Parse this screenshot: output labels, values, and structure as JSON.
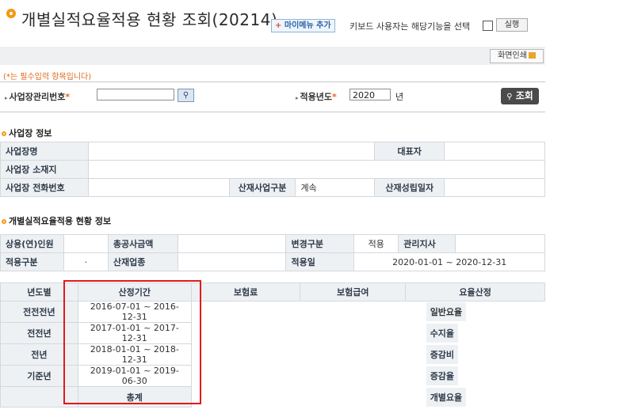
{
  "header": {
    "title": "개별실적요율적용 현황 조회(20214)",
    "mymenu_plus": "+",
    "mymenu_label": "마이메뉴 추가",
    "keyboard_text": "키보드 사용자는 해당기능을 선택",
    "run_label": "실행"
  },
  "toolbar": {
    "print_label": "화면인쇄"
  },
  "required_note": "(*는 필수입력 항목입니다)",
  "search": {
    "workplace_label": "사업장관리번호",
    "workplace_value": "",
    "year_label": "적용년도",
    "year_value": "2020",
    "year_unit": "년",
    "star": "*",
    "query_label": "조회",
    "query_icon": "magnifier-icon"
  },
  "workplace_info": {
    "section_title": "사업장 정보",
    "name_label": "사업장명",
    "name_value": "",
    "rep_label": "대표자",
    "rep_value": "",
    "addr_label": "사업장 소재지",
    "addr_value": "",
    "phone_label": "사업장 전화번호",
    "phone_value": "",
    "biztype_label": "산재사업구분",
    "biztype_value": "계속",
    "estdate_label": "산재성립일자",
    "estdate_value": ""
  },
  "rate_info": {
    "section_title": "개별실적요율적용 현황 정보",
    "workers_label": "상용(연)인원",
    "workers_value": "",
    "wage_label": "총공사금액",
    "wage_value": "",
    "change_label": "변경구분",
    "change_value": "적용",
    "office_label": "관리지사",
    "office_value": "",
    "apptype_label": "적용구분",
    "apptype_value": "·",
    "industry_label": "산재업종",
    "industry_value": "",
    "appdate_label": "적용일",
    "appdate_value": "2020-01-01 ~ 2020-12-31"
  },
  "period_table": {
    "headers": [
      "년도별",
      "산정기간",
      "보험료",
      "보험급여",
      "요율산정"
    ],
    "rows": [
      {
        "year": "전전전년",
        "period": "2016-07-01 ~ 2016-12-31",
        "rate": "일반요율"
      },
      {
        "year": "전전년",
        "period": "2017-01-01 ~ 2017-12-31",
        "rate": "수지율"
      },
      {
        "year": "전년",
        "period": "2018-01-01 ~ 2018-12-31",
        "rate": "증감비"
      },
      {
        "year": "기준년",
        "period": "2019-01-01 ~ 2019-06-30",
        "rate": "증감율"
      }
    ],
    "total_label": "총계",
    "total_rate": "개별요율"
  }
}
